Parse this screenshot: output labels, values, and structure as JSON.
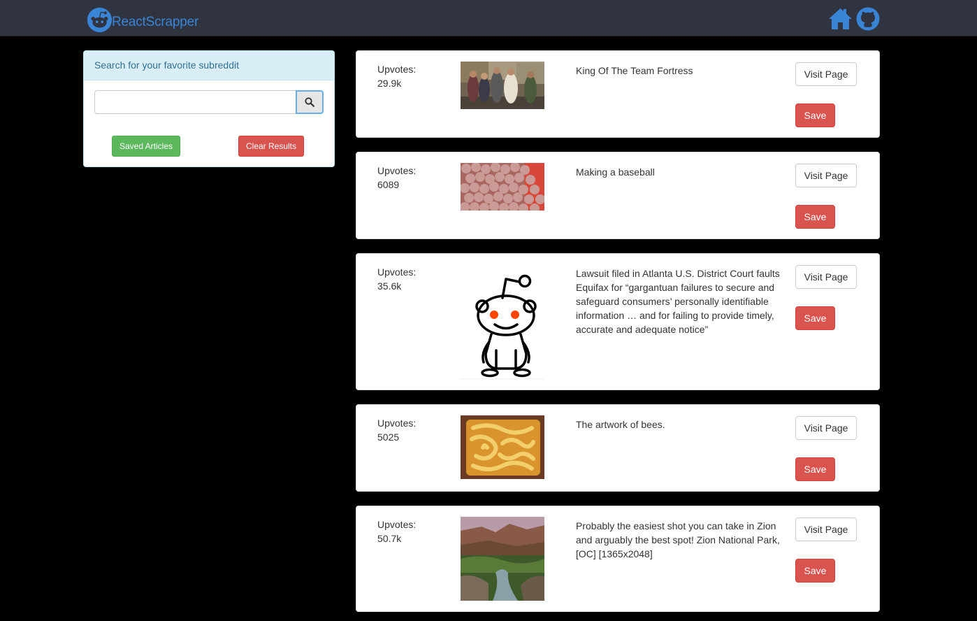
{
  "navbar": {
    "brand": "ReactScrapper",
    "icons": [
      "reddit-alien-icon",
      "home-icon",
      "github-icon"
    ],
    "accent_color": "#3a84d6"
  },
  "search_panel": {
    "heading": "Search for your favorite subreddit",
    "input_value": "",
    "input_placeholder": "",
    "search_icon": "search-icon",
    "saved_label": "Saved Articles",
    "clear_label": "Clear Results"
  },
  "articles": [
    {
      "upvotes_label": "Upvotes:",
      "upvotes": "29.9k",
      "title": "King Of The Team Fortress",
      "visit_label": "Visit Page",
      "save_label": "Save",
      "thumbnail": "team-fortress-thumbnail"
    },
    {
      "upvotes_label": "Upvotes:",
      "upvotes": "6089",
      "title": "Making a baseball",
      "visit_label": "Visit Page",
      "save_label": "Save",
      "thumbnail": "baseballs-thumbnail"
    },
    {
      "upvotes_label": "Upvotes:",
      "upvotes": "35.6k",
      "title": "Lawsuit filed in Atlanta U.S. District Court faults Equifax for “gargantuan failures to secure and safeguard consumers’ personally identifiable information … and for failing to provide timely, accurate and adequate notice”",
      "visit_label": "Visit Page",
      "save_label": "Save",
      "thumbnail": "reddit-alien-thumbnail"
    },
    {
      "upvotes_label": "Upvotes:",
      "upvotes": "5025",
      "title": "The artwork of bees.",
      "visit_label": "Visit Page",
      "save_label": "Save",
      "thumbnail": "honeycomb-thumbnail"
    },
    {
      "upvotes_label": "Upvotes:",
      "upvotes": "50.7k",
      "title": "Probably the easiest shot you can take in Zion and arguably the best spot! Zion National Park, [OC] [1365x2048]",
      "visit_label": "Visit Page",
      "save_label": "Save",
      "thumbnail": "zion-canyon-thumbnail"
    }
  ]
}
